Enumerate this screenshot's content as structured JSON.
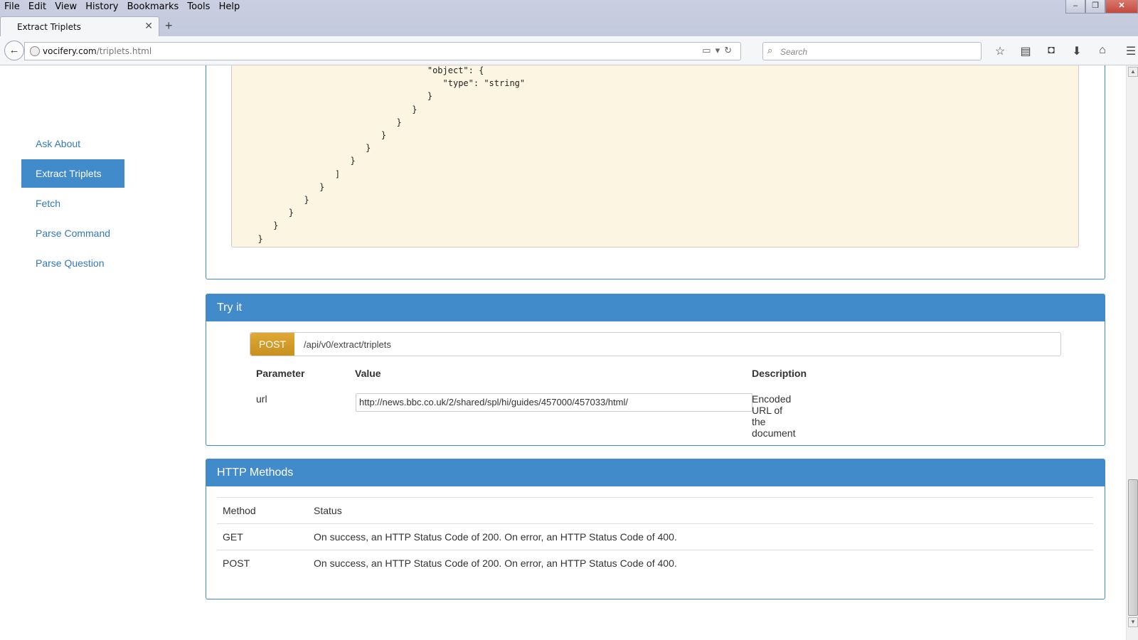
{
  "menubar": {
    "items": [
      "File",
      "Edit",
      "View",
      "History",
      "Bookmarks",
      "Tools",
      "Help"
    ]
  },
  "tab": {
    "title": "Extract Triplets",
    "close": "✕",
    "new_tab": "+"
  },
  "navbar": {
    "url_domain": "vocifery.com",
    "url_path": "/triplets.html",
    "search_placeholder": "Search"
  },
  "sidebar": {
    "items": [
      {
        "label": "Ask About",
        "active": false
      },
      {
        "label": "Extract Triplets",
        "active": true
      },
      {
        "label": "Fetch",
        "active": false
      },
      {
        "label": "Parse Command",
        "active": false
      },
      {
        "label": "Parse Question",
        "active": false
      }
    ]
  },
  "schema": {
    "code": "                                   \"object\": {\n                                      \"type\": \"string\"\n                                   }\n                                }\n                             }\n                          }\n                       }\n                    }\n                 ]\n              }\n           }\n        }\n     }\n  }"
  },
  "try_it": {
    "title": "Try it",
    "method": "POST",
    "endpoint": "/api/v0/extract/triplets",
    "headers": {
      "parameter": "Parameter",
      "value": "Value",
      "description": "Description"
    },
    "param_name": "url",
    "param_value": "http://news.bbc.co.uk/2/shared/spl/hi/guides/457000/457033/html/",
    "param_description": "Encoded URL of the document"
  },
  "http_methods": {
    "title": "HTTP Methods",
    "headers": {
      "method": "Method",
      "status": "Status"
    },
    "rows": [
      {
        "method": "GET",
        "status": "On success, an HTTP Status Code of 200. On error, an HTTP Status Code of 400."
      },
      {
        "method": "POST",
        "status": "On success, an HTTP Status Code of 200. On error, an HTTP Status Code of 400."
      }
    ]
  }
}
